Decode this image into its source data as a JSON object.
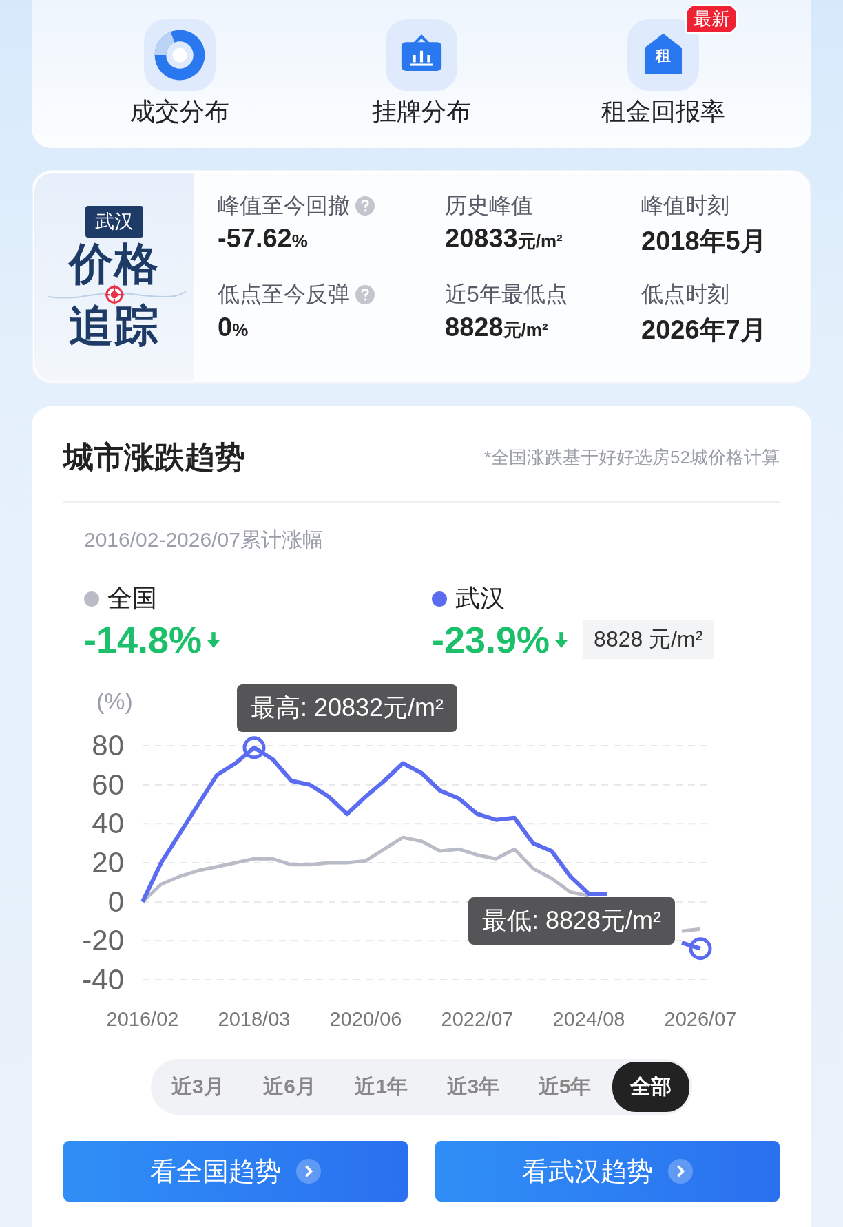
{
  "shortcuts": [
    {
      "label": "成交分布",
      "kind": "donut"
    },
    {
      "label": "挂牌分布",
      "kind": "board"
    },
    {
      "label": "租金回报率",
      "kind": "house",
      "icon_glyph": "租",
      "badge": "最新"
    }
  ],
  "tracker": {
    "city": "武汉",
    "title_lines": [
      "价格",
      "追踪"
    ],
    "stats": [
      {
        "label": "峰值至今回撤",
        "help": true,
        "value": "-57.62",
        "unit": "%"
      },
      {
        "label": "历史峰值",
        "help": false,
        "value": "20833",
        "unit": "元/m²"
      },
      {
        "label": "峰值时刻",
        "help": false,
        "value": "2018年5月"
      },
      {
        "label": "低点至今反弹",
        "help": true,
        "value": "0",
        "unit": "%"
      },
      {
        "label": "近5年最低点",
        "help": false,
        "value": "8828",
        "unit": "元/m²"
      },
      {
        "label": "低点时刻",
        "help": false,
        "value": "2026年7月"
      }
    ]
  },
  "trend": {
    "title": "城市涨跌趋势",
    "note": "*全国涨跌基于好好选房52城价格计算",
    "period": "2016/02-2026/07累计涨幅",
    "legend": [
      {
        "change": "-14.8%"
      },
      {
        "change": "-23.9%",
        "price": "8828 元/m²"
      }
    ],
    "chart_data": {
      "type": "line",
      "ylabel": "(%)",
      "grid": true,
      "categories": [
        "2016/02",
        null,
        null,
        null,
        null,
        null,
        "2018/03",
        null,
        null,
        null,
        null,
        null,
        "2020/06",
        null,
        null,
        null,
        null,
        null,
        "2022/07",
        null,
        null,
        null,
        null,
        null,
        "2024/08",
        null,
        null,
        null,
        null,
        null,
        "2026/07"
      ],
      "yticks": [
        80,
        60,
        40,
        20,
        0,
        -20,
        -40
      ],
      "ylim": [
        -40,
        80
      ],
      "series": [
        {
          "name": "全国",
          "color": "#b9bcc6",
          "values": [
            0,
            9,
            13,
            16,
            18,
            20,
            22,
            22,
            19,
            19,
            20,
            20,
            21,
            27,
            33,
            31,
            26,
            27,
            24,
            22,
            27,
            17,
            12,
            5,
            3,
            null,
            null,
            null,
            null,
            -15,
            -14
          ]
        },
        {
          "name": "武汉",
          "color": "#5b6cf0",
          "values": [
            0,
            20,
            35,
            50,
            65,
            71,
            79,
            73,
            62,
            60,
            54,
            45,
            54,
            62,
            71,
            66,
            57,
            53,
            45,
            42,
            43,
            30,
            26,
            13,
            4,
            4,
            null,
            null,
            null,
            -21,
            -24
          ]
        }
      ],
      "annotations": [
        "最高: 20832元/m²",
        "最低: 8828元/m²"
      ]
    },
    "ranges": [
      {
        "label": "近3月",
        "selected": false
      },
      {
        "label": "近6月",
        "selected": false
      },
      {
        "label": "近1年",
        "selected": false
      },
      {
        "label": "近3年",
        "selected": false
      },
      {
        "label": "近5年",
        "selected": false
      },
      {
        "label": "全部",
        "selected": true
      }
    ],
    "buttons": [
      {
        "label": "看全国趋势"
      },
      {
        "label": "看武汉趋势"
      }
    ]
  }
}
